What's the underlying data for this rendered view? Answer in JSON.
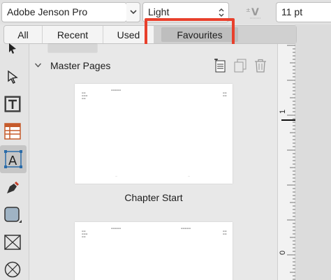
{
  "font_toolbar": {
    "font_family": "Adobe Jenson Pro",
    "font_style": "Light",
    "font_size": "11 pt",
    "kerning_icon": "kerning-icon"
  },
  "tabs": {
    "items": [
      {
        "label": "All"
      },
      {
        "label": "Recent"
      },
      {
        "label": "Used"
      },
      {
        "label": "Favourites",
        "active": true
      }
    ],
    "highlight_color": "#e8402c"
  },
  "tools": [
    "move-tool-icon",
    "node-tool-icon",
    "frame-text-tool-icon",
    "table-tool-icon",
    "artistic-text-tool-icon",
    "pen-tool-icon",
    "shape-tool-icon",
    "picture-frame-icon",
    "vector-crop-icon"
  ],
  "panel": {
    "section_title": "Master Pages",
    "master_pages": [
      {
        "caption": "Chapter Start"
      },
      {
        "caption": ""
      }
    ]
  },
  "ruler": {
    "labels": [
      "1",
      "0"
    ]
  }
}
